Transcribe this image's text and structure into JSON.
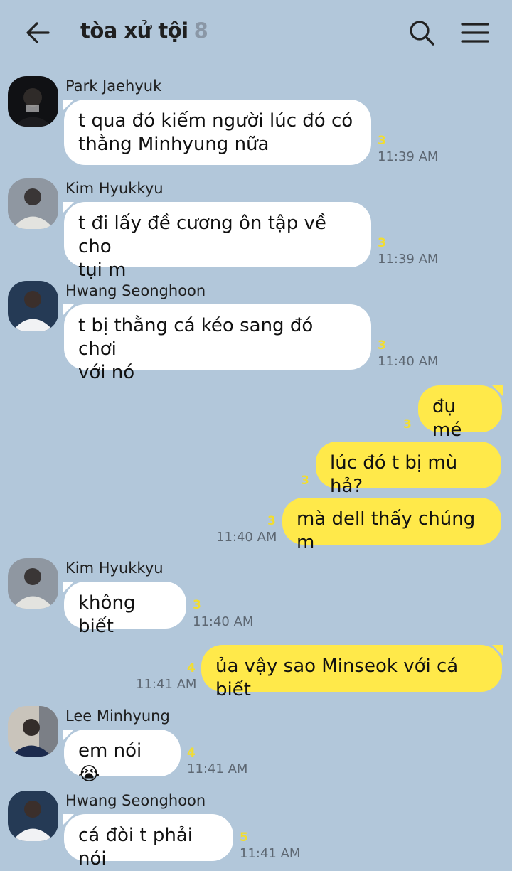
{
  "header": {
    "title": "tòa xử tội",
    "member_count": "8"
  },
  "messages": [
    {
      "sender": "Park Jaehyuk",
      "text": "t qua đó kiếm người lúc đó có\nthằng Minhyung nữa",
      "unread": "3",
      "time": "11:39 AM"
    },
    {
      "sender": "Kim Hyukkyu",
      "text": "t đi lấy đề cương ôn tập về cho\ntụi m",
      "unread": "3",
      "time": "11:39 AM"
    },
    {
      "sender": "Hwang Seonghoon",
      "text": "t bị thằng cá kéo sang đó chơi\nvới nó",
      "unread": "3",
      "time": "11:40 AM"
    },
    {
      "text": "đụ mé",
      "unread": "3"
    },
    {
      "text": "lúc đó t bị mù hả?",
      "unread": "3"
    },
    {
      "text": "mà dell thấy chúng m",
      "unread": "3",
      "time": "11:40 AM"
    },
    {
      "sender": "Kim Hyukkyu",
      "text": "không biết",
      "unread": "3",
      "time": "11:40 AM"
    },
    {
      "text": "ủa vậy sao Minseok với cá biết",
      "unread": "4",
      "time": "11:41 AM"
    },
    {
      "sender": "Lee Minhyung",
      "text": "em nói 😭",
      "unread": "4",
      "time": "11:41 AM"
    },
    {
      "sender": "Hwang Seonghoon",
      "text": "cá đòi t phải nói",
      "unread": "5",
      "time": "11:41 AM"
    }
  ],
  "colors": {
    "background": "#b2c7da",
    "outgoing_bubble": "#ffe94a",
    "incoming_bubble": "#ffffff",
    "unread_count": "#f2dd2f"
  },
  "icons": [
    "back-arrow-icon",
    "search-icon",
    "menu-icon"
  ]
}
